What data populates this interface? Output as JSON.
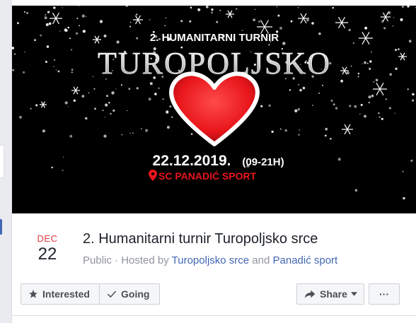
{
  "cover": {
    "kicker": "2. HUMANITARNI TURNIR",
    "headline": "TUROPOLJSKO",
    "date_line": "22.12.2019.",
    "time_line": "(09-21H)",
    "venue": "SC PANADIĆ SPORT"
  },
  "event": {
    "month": "DEC",
    "day": "22",
    "title": "2. Humanitarni turnir Turopoljsko srce",
    "privacy": "Public",
    "separator": " · ",
    "hosted_by_prefix": "Hosted by ",
    "host1": "Turopoljsko srce",
    "and_word": " and ",
    "host2": "Panadić sport"
  },
  "actions": {
    "interested_label": "Interested",
    "going_label": "Going",
    "share_label": "Share",
    "more_label": "···"
  },
  "icons": {
    "interested": "star-icon",
    "going": "check-icon",
    "share": "share-arrow-icon",
    "dropdown": "caret-down-icon",
    "more": "ellipsis-icon"
  },
  "colors": {
    "month": "#e0393e",
    "link": "#4267b2",
    "heart": "#e8161b",
    "venue": "#e8161b"
  }
}
